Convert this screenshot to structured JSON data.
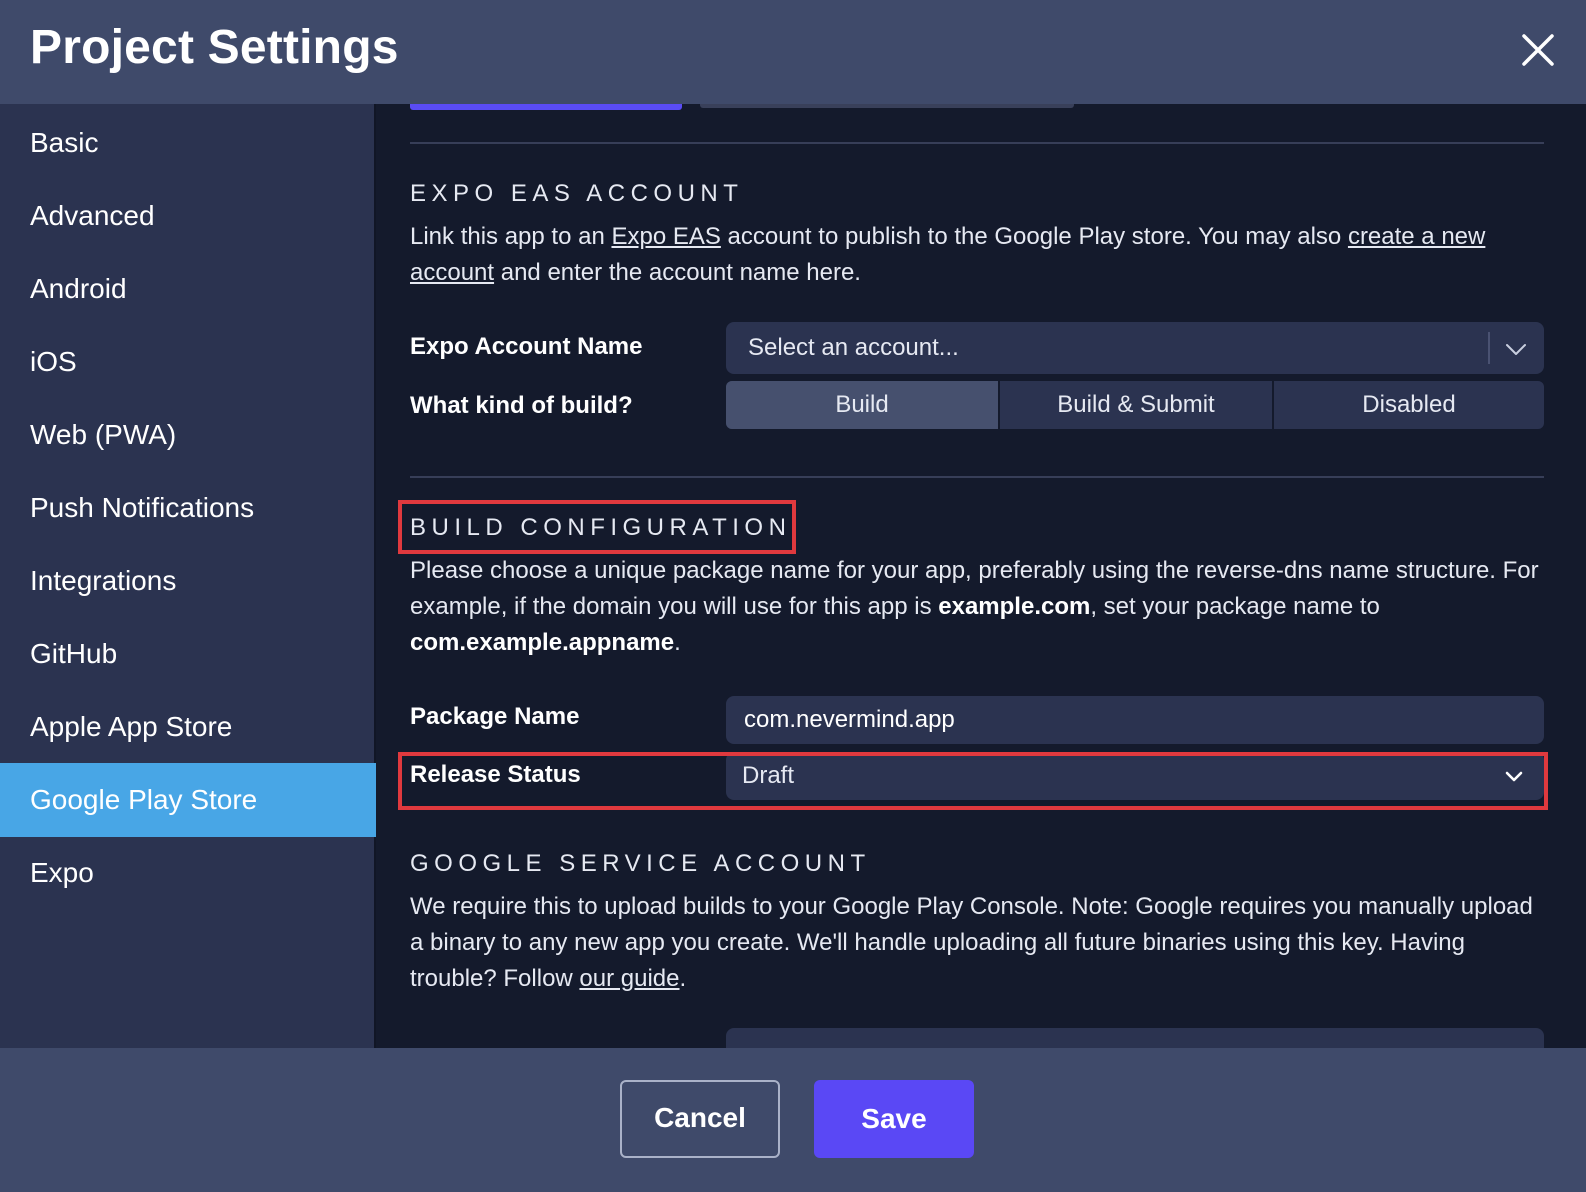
{
  "header": {
    "title": "Project Settings"
  },
  "sidebar": {
    "items": [
      {
        "label": "Basic"
      },
      {
        "label": "Advanced"
      },
      {
        "label": "Android"
      },
      {
        "label": "iOS"
      },
      {
        "label": "Web (PWA)"
      },
      {
        "label": "Push Notifications"
      },
      {
        "label": "Integrations"
      },
      {
        "label": "GitHub"
      },
      {
        "label": "Apple App Store"
      },
      {
        "label": "Google Play Store"
      },
      {
        "label": "Expo"
      }
    ],
    "active": "Google Play Store"
  },
  "expo": {
    "title": "EXPO EAS ACCOUNT",
    "desc": {
      "t1": "Link this app to an ",
      "link1": "Expo EAS",
      "t2": " account to publish to the Google Play store. You may also ",
      "link2": "create a new account",
      "t3": " and enter the account name here."
    },
    "account_label": "Expo Account Name",
    "account_placeholder": "Select an account...",
    "build_label": "What kind of build?",
    "build_options": [
      "Build",
      "Build & Submit",
      "Disabled"
    ],
    "build_selected": "Build"
  },
  "build_config": {
    "title": "BUILD CONFIGURATION",
    "desc": {
      "t1": "Please choose a unique package name for your app, preferably using the reverse-dns name structure. For example, if the domain you will use for this app is ",
      "b1": "example.com",
      "t2": ", set your package name to ",
      "b2": "com.example.appname",
      "t3": "."
    },
    "package_label": "Package Name",
    "package_value": "com.nevermind.app",
    "release_label": "Release Status",
    "release_value": "Draft"
  },
  "google_service": {
    "title": "GOOGLE SERVICE ACCOUNT",
    "desc": {
      "t1": "We require this to upload builds to your Google Play Console. Note: Google requires you manually upload a binary to any new app you create. We'll handle uploading all future binaries using this key. Having trouble? Follow ",
      "link1": "our guide",
      "t2": "."
    }
  },
  "footer": {
    "cancel_label": "Cancel",
    "save_label": "Save"
  },
  "colors": {
    "accent": "#5a48f5",
    "active_nav": "#48a6e6",
    "highlight": "#e0393e"
  }
}
